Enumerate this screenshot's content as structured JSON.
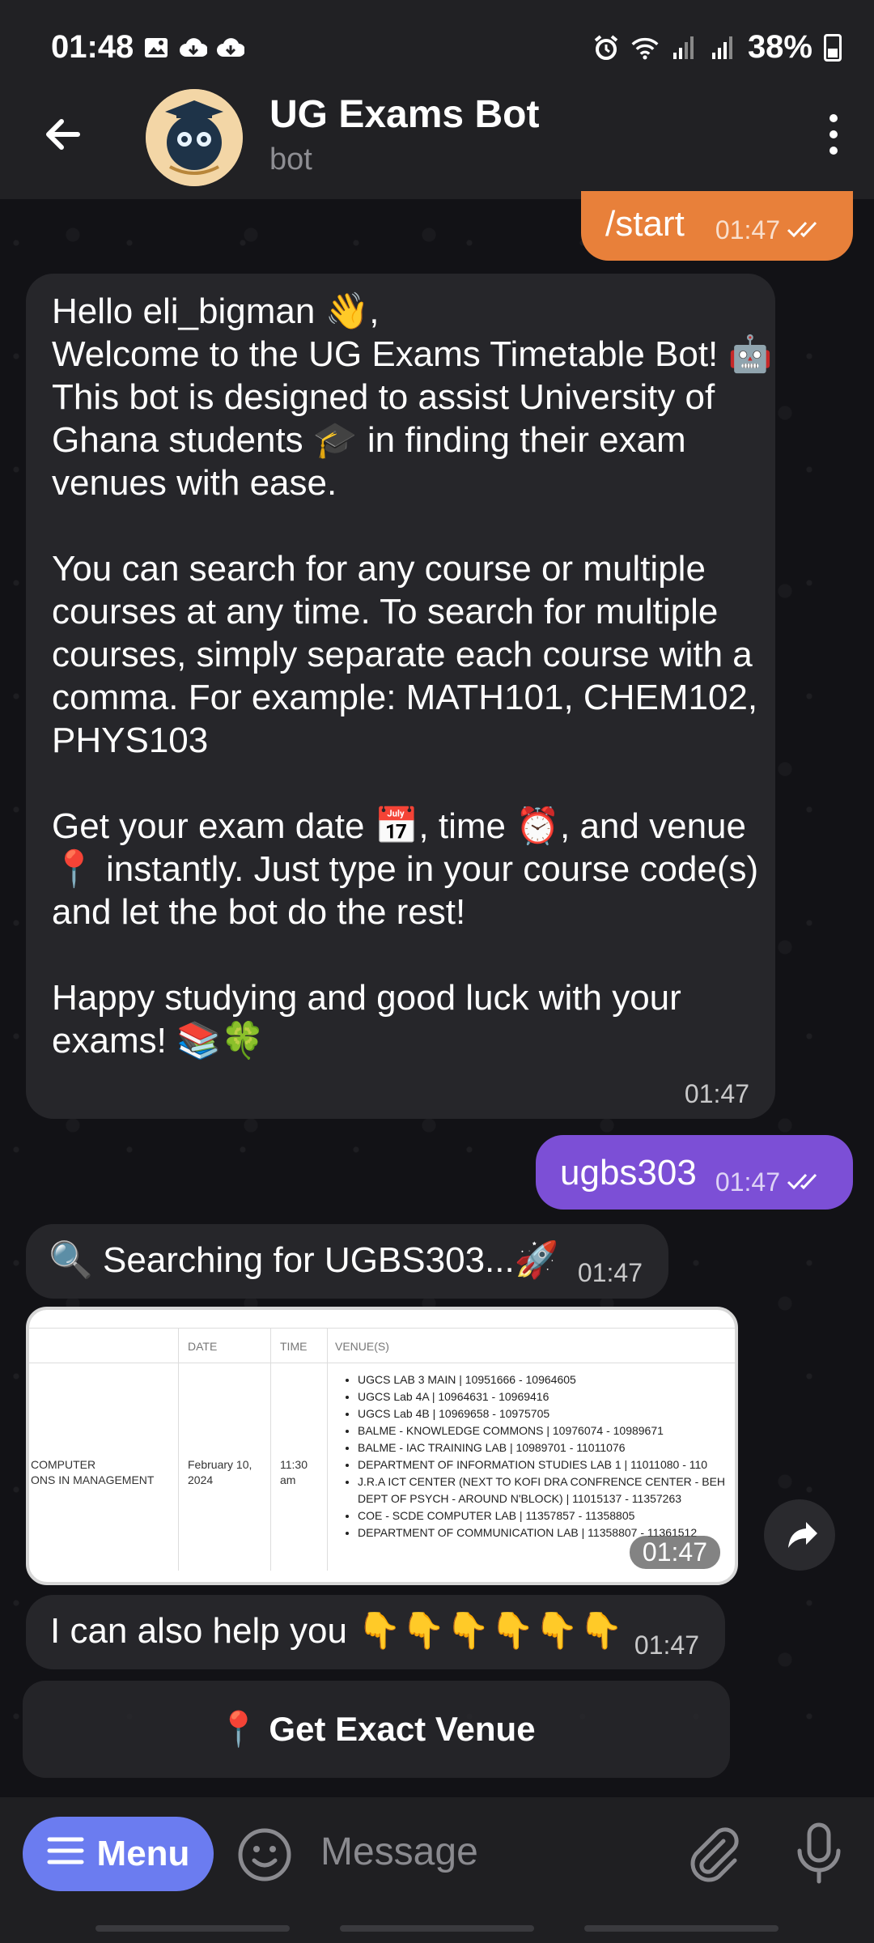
{
  "status_bar": {
    "time": "01:48",
    "battery": "38%",
    "battery_level": 0.38,
    "icons": [
      "image-icon",
      "cloud-download-icon",
      "cloud-download-icon",
      "alarm-icon",
      "wifi-icon",
      "signal-icon",
      "signal-icon",
      "battery-icon"
    ]
  },
  "chat_header": {
    "title": "UG Exams Bot",
    "subtitle": "bot"
  },
  "messages": {
    "start": {
      "text": "/start",
      "time": "01:47"
    },
    "welcome": {
      "text": "Hello eli_bigman 👋,\nWelcome to the UG Exams Timetable Bot! 🤖\nThis bot is designed to assist University of Ghana students 🎓 in finding their exam venues with ease.\n\nYou can search for any course or multiple courses at any time. To search for multiple courses, simply separate each course with a comma. For example: MATH101, CHEM102, PHYS103\n\nGet your exam date 📅, time ⏰, and venue 📍 instantly. Just type in your course code(s) and let the bot do the rest!\n\nHappy studying and good luck with your exams! 📚🍀",
      "time": "01:47"
    },
    "query": {
      "text": "ugbs303",
      "time": "01:47"
    },
    "searching": {
      "text": "🔍 Searching for UGBS303...🚀",
      "time": "01:47"
    },
    "image": {
      "time": "01:47",
      "headers": {
        "date": "DATE",
        "time": "TIME",
        "venues": "VENUE(S)"
      },
      "course_line1": "COMPUTER",
      "course_line2": "ONS IN MANAGEMENT",
      "date_line1": "February 10,",
      "date_line2": "2024",
      "time_line1": "11:30",
      "time_line2": "am",
      "venues": [
        "UGCS LAB 3 MAIN | 10951666 - 10964605",
        "UGCS Lab 4A | 10964631 - 10969416",
        "UGCS Lab 4B | 10969658 - 10975705",
        "BALME - KNOWLEDGE COMMONS | 10976074 - 10989671",
        "BALME - IAC TRAINING LAB | 10989701 - 11011076",
        "DEPARTMENT OF INFORMATION STUDIES LAB 1 | 11011080 - 110",
        "J.R.A ICT CENTER (NEXT TO KOFI DRA CONFRENCE CENTER - BEH",
        "DEPT OF PSYCH - AROUND N'BLOCK) | 11015137 - 11357263",
        "COE - SCDE COMPUTER LAB | 11357857 - 11358805",
        "DEPARTMENT OF COMMUNICATION LAB | 11358807 - 11361512"
      ]
    },
    "help": {
      "text": "I can also help you 👇👇👇👇👇👇",
      "time": "01:47"
    }
  },
  "inline_button": {
    "label": "📍 Get Exact Venue"
  },
  "composer": {
    "menu_label": "Menu",
    "placeholder": "Message"
  },
  "colors": {
    "start_bubble": "#e8803a",
    "query_bubble": "#7c4fd6",
    "menu_button": "#6b7cf0"
  }
}
